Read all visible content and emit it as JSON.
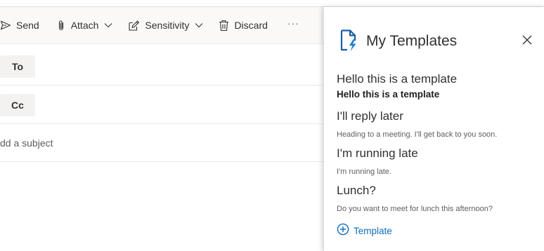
{
  "toolbar": {
    "send_label": "Send",
    "attach_label": "Attach",
    "sensitivity_label": "Sensitivity",
    "discard_label": "Discard",
    "more_label": "···"
  },
  "compose": {
    "to_label": "To",
    "cc_label": "Cc",
    "subject_placeholder": "dd a subject"
  },
  "templates_panel": {
    "title": "My Templates",
    "items": [
      {
        "title": "Hello this is a template",
        "body": "Hello this is a template"
      },
      {
        "title": "I'll reply later",
        "body": "Heading to a meeting. I'll get back to you soon."
      },
      {
        "title": "I'm running late",
        "body": "I'm running late."
      },
      {
        "title": "Lunch?",
        "body": "Do you want to meet for lunch this afternoon?"
      }
    ],
    "add_label": "Template"
  },
  "colors": {
    "accent": "#0f6cbd",
    "toolbar_bg": "#faf9f8",
    "recipient_button_bg": "#f3f2f1"
  },
  "icons": {
    "send": "send-icon",
    "attach": "paperclip-icon",
    "sensitivity": "sensitivity-icon",
    "discard": "trash-icon",
    "panel_logo": "templates-logo-icon",
    "close": "close-icon",
    "add": "add-circle-icon"
  }
}
